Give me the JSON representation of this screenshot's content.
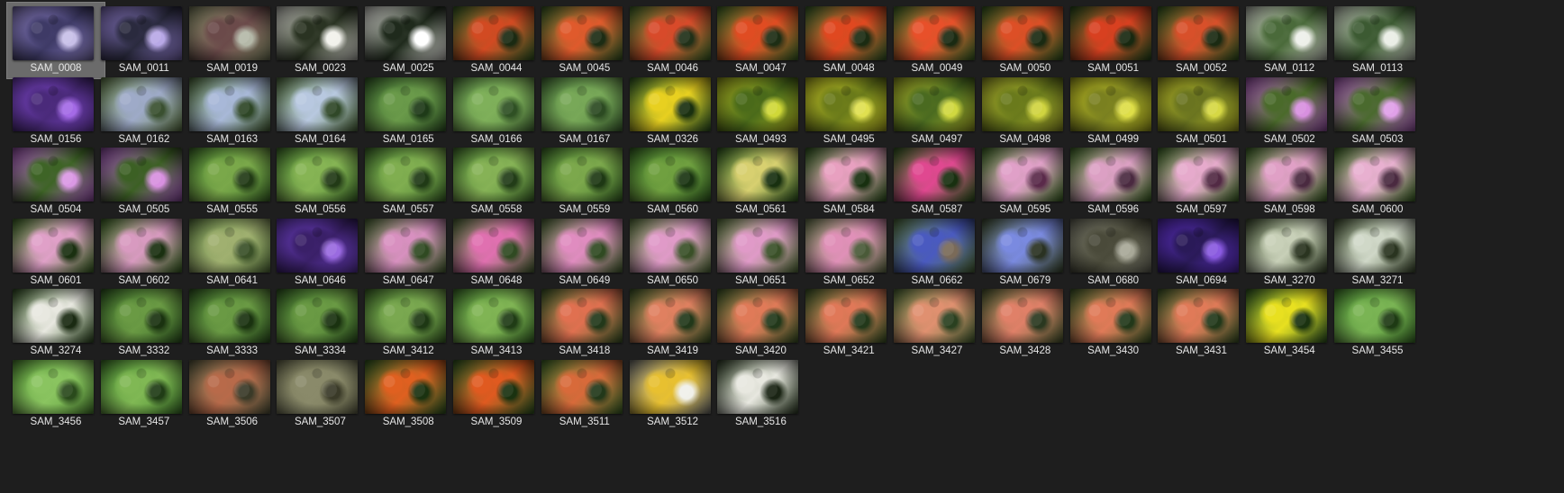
{
  "thumbnails": [
    {
      "label": "SAM_0008",
      "selected": true,
      "colors": [
        "#8b7fc2",
        "#3e3a66",
        "#c8c0e8"
      ]
    },
    {
      "label": "SAM_0011",
      "colors": [
        "#8a78c6",
        "#2a2a3e",
        "#b8a8e6"
      ]
    },
    {
      "label": "SAM_0019",
      "colors": [
        "#8a8f6a",
        "#6b4a4a",
        "#b4b8a8"
      ]
    },
    {
      "label": "SAM_0023",
      "colors": [
        "#d8d8d0",
        "#2a3322",
        "#f2f2ec"
      ]
    },
    {
      "label": "SAM_0025",
      "colors": [
        "#e6e6e0",
        "#1f2a1c",
        "#ffffff"
      ]
    },
    {
      "label": "SAM_0044",
      "colors": [
        "#3f6b2a",
        "#d24a22",
        "#1a2a12"
      ]
    },
    {
      "label": "SAM_0045",
      "colors": [
        "#446d2c",
        "#e05a2c",
        "#1c2c14"
      ]
    },
    {
      "label": "SAM_0046",
      "colors": [
        "#4b7a30",
        "#d84a2a",
        "#203018"
      ]
    },
    {
      "label": "SAM_0047",
      "colors": [
        "#4a7a2e",
        "#e04c22",
        "#1d2d14"
      ]
    },
    {
      "label": "SAM_0048",
      "colors": [
        "#437231",
        "#e04820",
        "#1b2b12"
      ]
    },
    {
      "label": "SAM_0049",
      "colors": [
        "#4a7a2e",
        "#e8502a",
        "#1a2a12"
      ]
    },
    {
      "label": "SAM_0050",
      "colors": [
        "#3f6d28",
        "#dd4f26",
        "#1a2a12"
      ]
    },
    {
      "label": "SAM_0051",
      "colors": [
        "#2f5a22",
        "#d84020",
        "#182810"
      ]
    },
    {
      "label": "SAM_0052",
      "colors": [
        "#3c6a28",
        "#d8502a",
        "#1a2a12"
      ]
    },
    {
      "label": "SAM_0112",
      "colors": [
        "#cfd3c7",
        "#4a6a3a",
        "#eef0ea"
      ]
    },
    {
      "label": "SAM_0113",
      "colors": [
        "#c8d0c0",
        "#3c5a32",
        "#eaeee6"
      ]
    },
    {
      "label": "SAM_0156",
      "colors": [
        "#7b45c8",
        "#4a2a7a",
        "#a46ae6"
      ]
    },
    {
      "label": "SAM_0162",
      "colors": [
        "#6f8a54",
        "#9eaac8",
        "#3a5030"
      ]
    },
    {
      "label": "SAM_0163",
      "colors": [
        "#5a7a46",
        "#a8b8d8",
        "#2e4626"
      ]
    },
    {
      "label": "SAM_0164",
      "colors": [
        "#5e7e4a",
        "#b8c8e0",
        "#304828"
      ]
    },
    {
      "label": "SAM_0165",
      "colors": [
        "#3d6b2f",
        "#6a9a4a",
        "#1e3a18"
      ]
    },
    {
      "label": "SAM_0166",
      "colors": [
        "#5a8a45",
        "#7fb05a",
        "#2f5024"
      ]
    },
    {
      "label": "SAM_0167",
      "colors": [
        "#507f3f",
        "#78a858",
        "#2c4a22"
      ]
    },
    {
      "label": "SAM_0326",
      "colors": [
        "#3a6a2a",
        "#e8d020",
        "#1a3010"
      ]
    },
    {
      "label": "SAM_0493",
      "colors": [
        "#a8b020",
        "#4a6a1a",
        "#d0d838"
      ]
    },
    {
      "label": "SAM_0495",
      "colors": [
        "#c0c024",
        "#6a7a1a",
        "#e0e050"
      ]
    },
    {
      "label": "SAM_0497",
      "colors": [
        "#a8b028",
        "#4a6a20",
        "#d0d840"
      ]
    },
    {
      "label": "SAM_0498",
      "colors": [
        "#a6aa2a",
        "#6a7a1c",
        "#d0d440"
      ]
    },
    {
      "label": "SAM_0499",
      "colors": [
        "#bcbc22",
        "#7a8020",
        "#dede48"
      ]
    },
    {
      "label": "SAM_0501",
      "colors": [
        "#b4b626",
        "#6a7420",
        "#d6d844"
      ]
    },
    {
      "label": "SAM_0502",
      "colors": [
        "#b060c0",
        "#4a6a2a",
        "#d890e0"
      ]
    },
    {
      "label": "SAM_0503",
      "colors": [
        "#b868c8",
        "#4a6a2e",
        "#e0a0e8"
      ]
    },
    {
      "label": "SAM_0504",
      "colors": [
        "#b060c6",
        "#3e6426",
        "#da98e4"
      ]
    },
    {
      "label": "SAM_0505",
      "colors": [
        "#a85cc0",
        "#3c6024",
        "#d890e0"
      ]
    },
    {
      "label": "SAM_0555",
      "colors": [
        "#4a8030",
        "#7aa84a",
        "#223a16"
      ]
    },
    {
      "label": "SAM_0556",
      "colors": [
        "#4c8232",
        "#86b454",
        "#223a16"
      ]
    },
    {
      "label": "SAM_0557",
      "colors": [
        "#4a7e32",
        "#80ae50",
        "#203a16"
      ]
    },
    {
      "label": "SAM_0558",
      "colors": [
        "#4e8234",
        "#86b256",
        "#223c18"
      ]
    },
    {
      "label": "SAM_0559",
      "colors": [
        "#467a2e",
        "#7ca84c",
        "#1e3814"
      ]
    },
    {
      "label": "SAM_0560",
      "colors": [
        "#3e7428",
        "#70a040",
        "#1a3412"
      ]
    },
    {
      "label": "SAM_0561",
      "colors": [
        "#3a6a26",
        "#d8d070",
        "#183010"
      ]
    },
    {
      "label": "SAM_0584",
      "colors": [
        "#3a6a26",
        "#e8a0c0",
        "#183010"
      ]
    },
    {
      "label": "SAM_0587",
      "colors": [
        "#3a6a26",
        "#e04890",
        "#183010"
      ]
    },
    {
      "label": "SAM_0595",
      "colors": [
        "#4a7a2e",
        "#e0a0c8",
        "#5a2a4a"
      ]
    },
    {
      "label": "SAM_0596",
      "colors": [
        "#4a7a2e",
        "#dca0c4",
        "#4a2a40"
      ]
    },
    {
      "label": "SAM_0597",
      "colors": [
        "#4a7a2e",
        "#e6aacc",
        "#522a44"
      ]
    },
    {
      "label": "SAM_0598",
      "colors": [
        "#4a7a2e",
        "#e0a0c6",
        "#4a2a40"
      ]
    },
    {
      "label": "SAM_0600",
      "colors": [
        "#4a7a2e",
        "#e8b0d0",
        "#4a2a40"
      ]
    },
    {
      "label": "SAM_0601",
      "colors": [
        "#4a7a2e",
        "#e0a0c8",
        "#1a3010"
      ]
    },
    {
      "label": "SAM_0602",
      "colors": [
        "#4a7a2e",
        "#d89ac0",
        "#1a3010"
      ]
    },
    {
      "label": "SAM_0641",
      "colors": [
        "#6a8a4a",
        "#a0b070",
        "#3a5028"
      ]
    },
    {
      "label": "SAM_0646",
      "colors": [
        "#6a3ec0",
        "#3a2068",
        "#9a6ae0"
      ]
    },
    {
      "label": "SAM_0647",
      "colors": [
        "#5a7a40",
        "#d890c0",
        "#304a22"
      ]
    },
    {
      "label": "SAM_0648",
      "colors": [
        "#5a7a40",
        "#e070b0",
        "#304a22"
      ]
    },
    {
      "label": "SAM_0649",
      "colors": [
        "#5a7a40",
        "#e08cc0",
        "#304a22"
      ]
    },
    {
      "label": "SAM_0650",
      "colors": [
        "#6a8a4a",
        "#e09ac8",
        "#3a5028"
      ]
    },
    {
      "label": "SAM_0651",
      "colors": [
        "#6a8a4a",
        "#e09ac8",
        "#3a5028"
      ]
    },
    {
      "label": "SAM_0652",
      "colors": [
        "#7a8a5a",
        "#e090b8",
        "#4a5a38"
      ]
    },
    {
      "label": "SAM_0662",
      "colors": [
        "#5a7a44",
        "#4a5ac0",
        "#7a6a58"
      ]
    },
    {
      "label": "SAM_0679",
      "colors": [
        "#4a5a3a",
        "#7a8ae0",
        "#2a3222"
      ]
    },
    {
      "label": "SAM_0680",
      "colors": [
        "#7a7a6a",
        "#4a4a3a",
        "#a8a898"
      ]
    },
    {
      "label": "SAM_0694",
      "colors": [
        "#5a2ec0",
        "#2a1a58",
        "#8a5ae0"
      ]
    },
    {
      "label": "SAM_3270",
      "colors": [
        "#4a5a3a",
        "#c8d0b8",
        "#2a3420"
      ]
    },
    {
      "label": "SAM_3271",
      "colors": [
        "#4a5a3a",
        "#d0d8c8",
        "#2a3420"
      ]
    },
    {
      "label": "SAM_3274",
      "colors": [
        "#3a5a2a",
        "#e8e8e0",
        "#1a2a12"
      ]
    },
    {
      "label": "SAM_3332",
      "colors": [
        "#3a6a28",
        "#6a9a44",
        "#1a3210"
      ]
    },
    {
      "label": "SAM_3333",
      "colors": [
        "#3a6a28",
        "#6a9a44",
        "#1a3210"
      ]
    },
    {
      "label": "SAM_3334",
      "colors": [
        "#3a6a28",
        "#6a9a44",
        "#1a3210"
      ]
    },
    {
      "label": "SAM_3412",
      "colors": [
        "#4a7a30",
        "#7aa850",
        "#1e3814"
      ]
    },
    {
      "label": "SAM_3413",
      "colors": [
        "#4a8432",
        "#80b454",
        "#203c16"
      ]
    },
    {
      "label": "SAM_3418",
      "colors": [
        "#4a6a30",
        "#e07050",
        "#22381a"
      ]
    },
    {
      "label": "SAM_3419",
      "colors": [
        "#4a6a30",
        "#e08060",
        "#22381a"
      ]
    },
    {
      "label": "SAM_3420",
      "colors": [
        "#4a6a30",
        "#e07a58",
        "#22381a"
      ]
    },
    {
      "label": "SAM_3421",
      "colors": [
        "#4a6a30",
        "#e07858",
        "#22381a"
      ]
    },
    {
      "label": "SAM_3427",
      "colors": [
        "#5a7a40",
        "#e09070",
        "#2a4020"
      ]
    },
    {
      "label": "SAM_3428",
      "colors": [
        "#5a6a3a",
        "#e08068",
        "#2a3820"
      ]
    },
    {
      "label": "SAM_3430",
      "colors": [
        "#4a6a30",
        "#e07a58",
        "#22381a"
      ]
    },
    {
      "label": "SAM_3431",
      "colors": [
        "#4a6a30",
        "#e07a58",
        "#22381a"
      ]
    },
    {
      "label": "SAM_3454",
      "colors": [
        "#3a6a28",
        "#e8e020",
        "#1a3210"
      ]
    },
    {
      "label": "SAM_3455",
      "colors": [
        "#4a8a32",
        "#7ab454",
        "#1e3a14"
      ]
    },
    {
      "label": "SAM_3456",
      "colors": [
        "#5a9a3a",
        "#8ac460",
        "#2a4a1c"
      ]
    },
    {
      "label": "SAM_3457",
      "colors": [
        "#4a8a32",
        "#80b854",
        "#203c16"
      ]
    },
    {
      "label": "SAM_3506",
      "colors": [
        "#6a6a4a",
        "#b86a4a",
        "#3a3a28"
      ]
    },
    {
      "label": "SAM_3507",
      "colors": [
        "#7a7a5a",
        "#8a8a6a",
        "#3a3a28"
      ]
    },
    {
      "label": "SAM_3508",
      "colors": [
        "#3a6a28",
        "#e06020",
        "#1a3210"
      ]
    },
    {
      "label": "SAM_3509",
      "colors": [
        "#3a6a28",
        "#e05a20",
        "#1a3210"
      ]
    },
    {
      "label": "SAM_3511",
      "colors": [
        "#4a7a30",
        "#d86a3a",
        "#22381a"
      ]
    },
    {
      "label": "SAM_3512",
      "colors": [
        "#8a8a86",
        "#e8c030",
        "#f0f0ea"
      ]
    },
    {
      "label": "SAM_3516",
      "colors": [
        "#3a4a30",
        "#e8e8e0",
        "#1a2414"
      ]
    }
  ]
}
